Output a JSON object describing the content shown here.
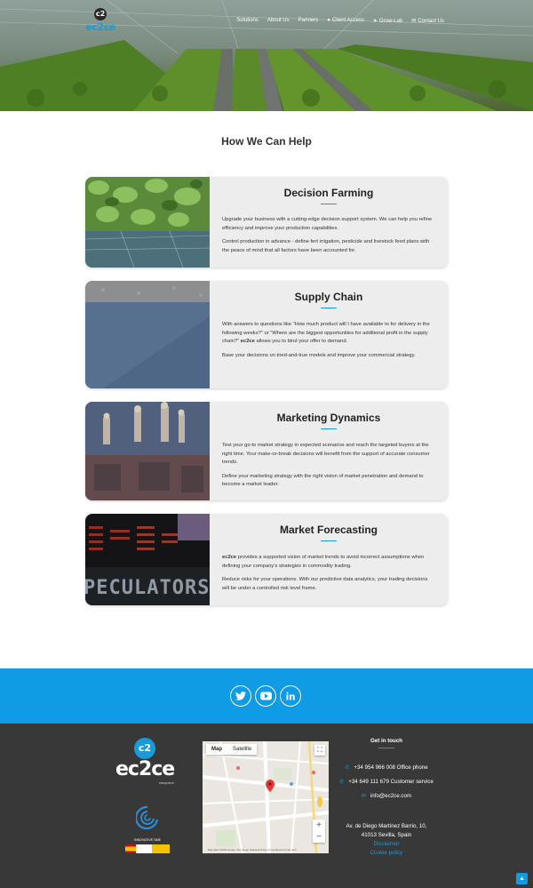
{
  "header": {
    "logo_mark": "c2",
    "logo_word": "ec2ce",
    "nav": [
      {
        "label": "Solutions",
        "icon": ""
      },
      {
        "label": "About Us",
        "icon": ""
      },
      {
        "label": "Partners",
        "icon": ""
      },
      {
        "label": "Client Access",
        "icon": "user-icon"
      },
      {
        "label": "Grow-Lab",
        "icon": "rocket-icon"
      },
      {
        "label": "Contact Us",
        "icon": "mail-icon"
      }
    ]
  },
  "section": {
    "title": "How We Can Help"
  },
  "cards": [
    {
      "title": "Decision Farming",
      "p1": "Upgrade your business with a cutting-edge decision support system. We can help you refine efficiency and improve your production capabilities.",
      "p2": "Control production in advance - define fert irrigation, pesticide and livestock feed plans with the peace of mind that all factors have been accounted for."
    },
    {
      "title": "Supply Chain",
      "p1_before": "With answers to questions like \"How much product will I have available to for delivery in the following weeks?\" or \"Where are the biggest opportunities for additional profit in the supply chain?\" ",
      "p1_bold": "ec2ce",
      "p1_after": " allows you to bind your offer to demand.",
      "p2": "Base your decisions on tried-and-true models and improve your commercial strategy."
    },
    {
      "title": "Marketing Dynamics",
      "p1": "Test your go-to market strategy in expected scenarios and reach the targeted buyers at the right time. Your make-or-break decisions will benefit from the support of accurate consumer trends.",
      "p2": "Define your marketing strategy with the right vision of market penetration and demand to become a market leader."
    },
    {
      "title": "Market Forecasting",
      "p1_bold": "ec2ce",
      "p1_after": " provides a supported vision of market trends to avoid incorrect assumptions when defining your company's strategies in commodity trading.",
      "p2": "Reduce risks for your operations. With our predictive data analytics, your trading decisions will be under a controlled risk level frame.",
      "image_text": "PECULATORS"
    }
  ],
  "social": [
    {
      "icon": "twitter-icon"
    },
    {
      "icon": "youtube-icon"
    },
    {
      "icon": "linkedin-icon"
    }
  ],
  "footer": {
    "logo_mark": "c2",
    "logo_word": "ec2ce",
    "logo_tag": "easyrisee",
    "sme_label": "INNOVATIVE SME",
    "map": {
      "tab_map": "Map",
      "tab_satellite": "Satellite",
      "attribution": "Map data ©2019 Google, Inst. Geogr. Nacional   Terms of Use   Report a map error"
    },
    "contact_title": "Get in touch",
    "office_phone": "+34 954 966 008 Office phone",
    "customer_service": "+34 649 111 679 Customer service",
    "email": "info@ec2ce.com",
    "address_line1": "Av. de Diego Martínez Barrio, 10,",
    "address_line2": "41013 Sevilla, Spain",
    "disclaimer": "Disclaimer",
    "cookie_policy": "Cookie policy"
  },
  "colors": {
    "accent": "#109be5",
    "footer_bg": "#383838",
    "card_bg": "#ededed"
  }
}
